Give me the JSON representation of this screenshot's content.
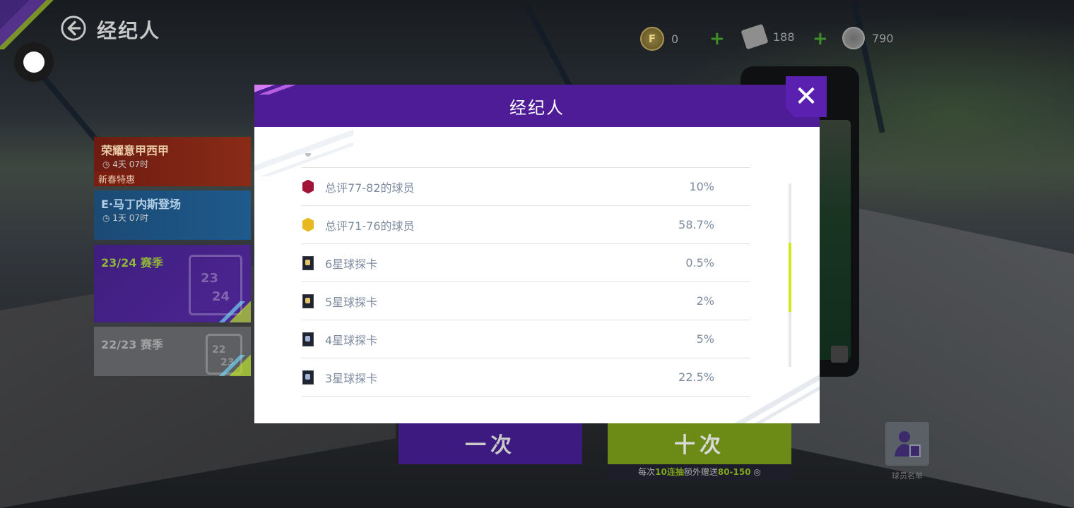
{
  "header": {
    "title": "经纪人"
  },
  "currencies": [
    {
      "name": "coin",
      "icon": "coin-icon",
      "value": "0"
    },
    {
      "name": "ticket",
      "icon": "ticket-icon",
      "value": "188"
    },
    {
      "name": "token",
      "icon": "token-icon",
      "value": "790"
    }
  ],
  "sidebar": {
    "items": [
      {
        "title": "荣耀意甲西甲",
        "timer": "4天 07时",
        "tag": "新春特惠"
      },
      {
        "title": "E·马丁内斯登场",
        "timer": "1天 07时"
      },
      {
        "title": "23/24 赛季",
        "cal_top": "23",
        "cal_bottom": "24"
      },
      {
        "title": "22/23 赛季",
        "cal_top": "22",
        "cal_bottom": "23"
      }
    ]
  },
  "actions": {
    "once_label": "一次",
    "ten_label": "十次",
    "ten_note_prefix": "每次",
    "ten_note_highlight_1": "10连抽",
    "ten_note_mid": "额外赠送",
    "ten_note_highlight_2": "80-150",
    "agent_list_label": "球员名单"
  },
  "modal": {
    "title": "经纪人",
    "close_icon": "close-icon",
    "rows": [
      {
        "icon": "red-hex",
        "label": "总评77-82的球员",
        "value": "10%"
      },
      {
        "icon": "gold-hex",
        "label": "总评71-76的球员",
        "value": "58.7%"
      },
      {
        "icon": "scout-card",
        "label": "6星球探卡",
        "value": "0.5%"
      },
      {
        "icon": "scout-card",
        "label": "5星球探卡",
        "value": "2%"
      },
      {
        "icon": "scout-card",
        "label": "4星球探卡",
        "value": "5%"
      },
      {
        "icon": "scout-card",
        "label": "3星球探卡",
        "value": "22.5%"
      }
    ]
  },
  "colors": {
    "modal_header": "#4e1c96",
    "accent_green": "#b8e02a",
    "text_gray": "#7d8ba0"
  }
}
